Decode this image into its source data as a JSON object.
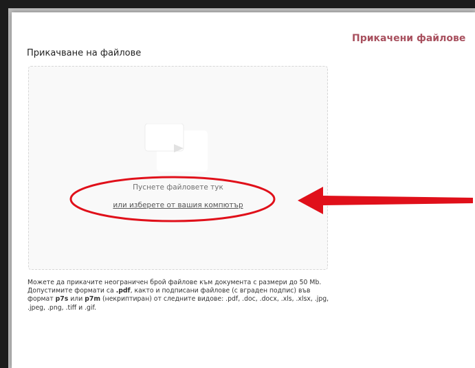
{
  "panel": {
    "right_title": "Прикачени файлове",
    "section_label": "Прикачване на файлове"
  },
  "dropzone": {
    "icon": "files-icon",
    "drop_text": "Пуснете файловете тук",
    "pick_link": "или изберете от вашия компютър"
  },
  "help": {
    "part1": "Можете да прикачите неограничен брой файлове към документа с размери до 50 Mb. Допустимите формати са ",
    "fmt_pdf": ".pdf",
    "part2": ", както и подписани файлове (с вграден подпис) във формат ",
    "fmt_p7s": "p7s",
    "part3": " или ",
    "fmt_p7m": "p7m",
    "part4": " (некриптиран) от следните видове: .pdf, .doc, .docx, .xls, .xlsx, .jpg, .jpeg, .png, .tiff и .gif."
  },
  "colors": {
    "accent": "#a8505e",
    "annotation": "#e0101a"
  }
}
